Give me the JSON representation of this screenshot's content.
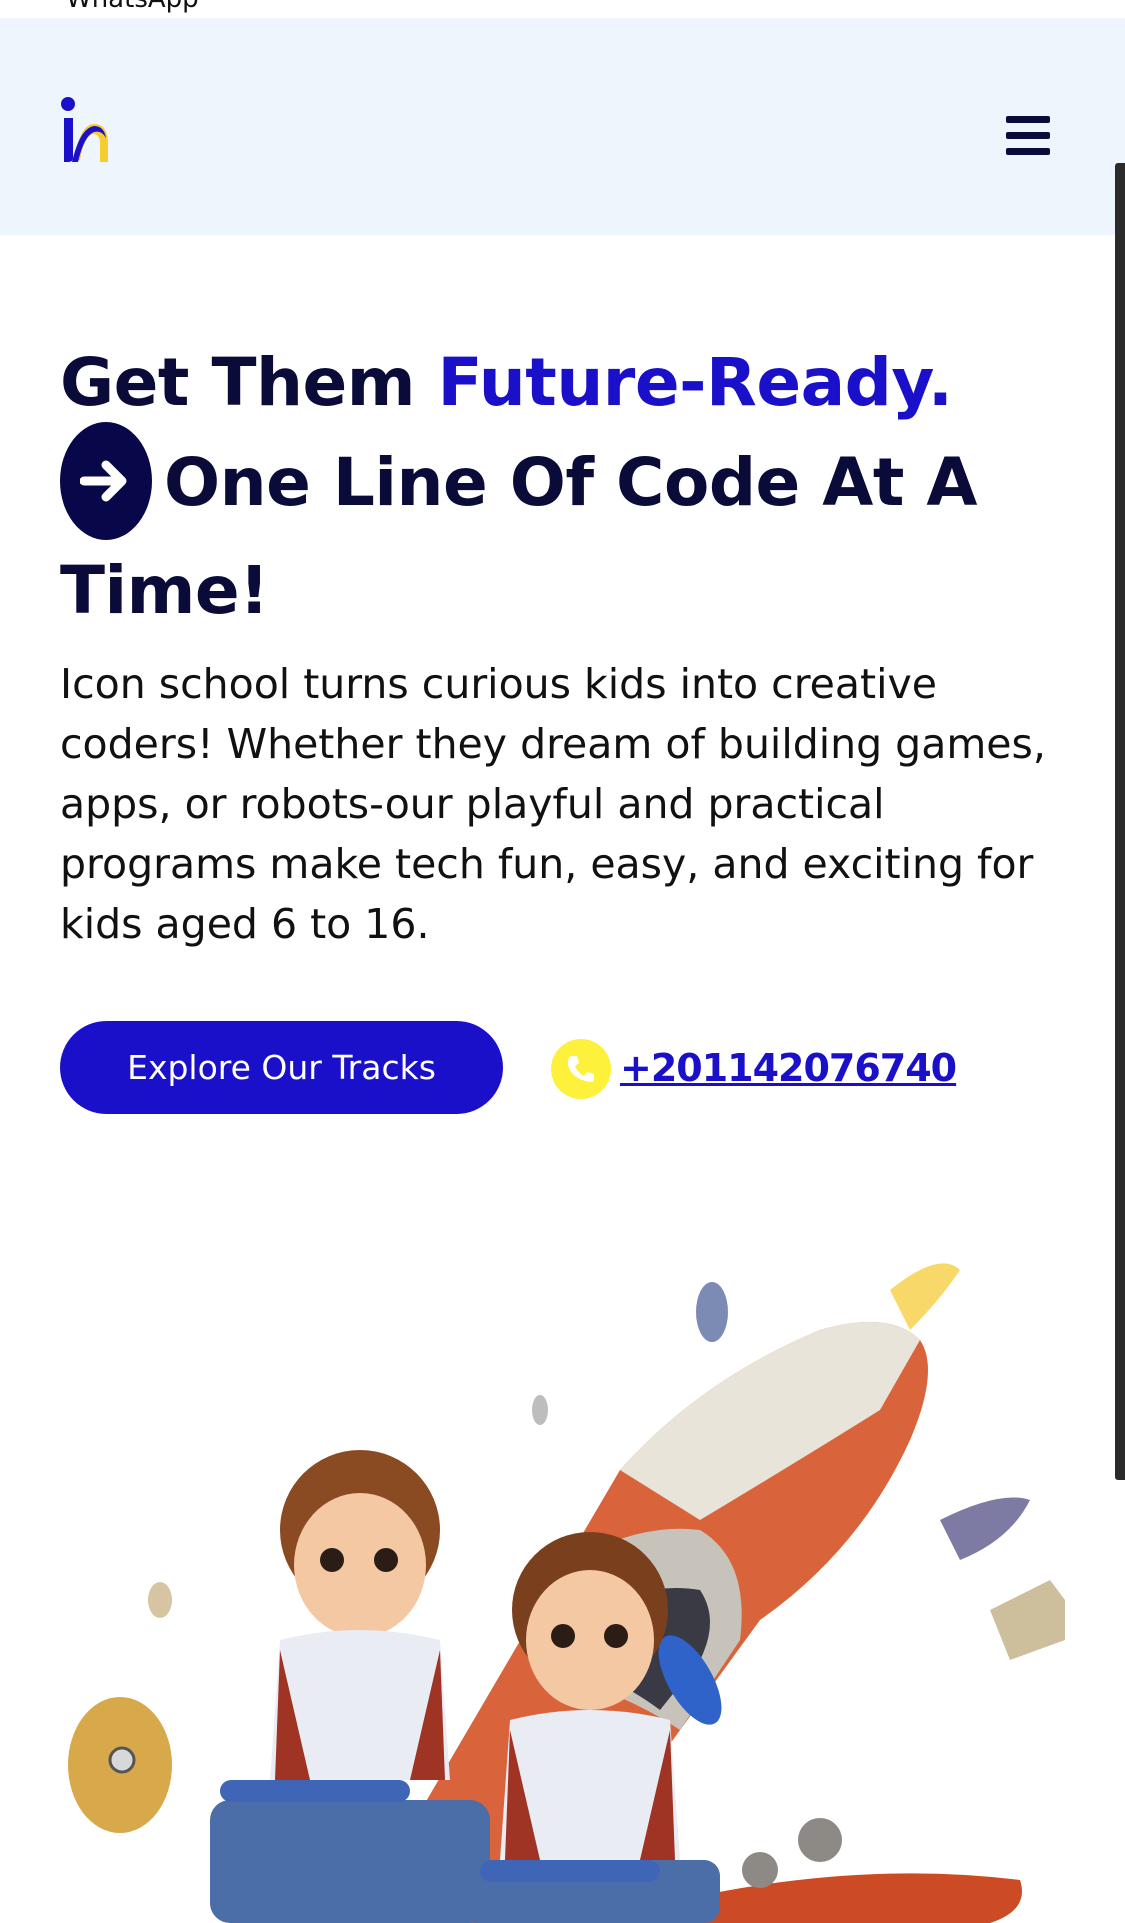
{
  "top_strip": {
    "text": "WhatsApp"
  },
  "header": {
    "logo_alt": "Icon school logo"
  },
  "hero": {
    "title_part1": "Get Them ",
    "title_accent": "Future-Ready.",
    "title_part2": "One Line Of Code At A Time!",
    "description": "Icon school turns curious kids into creative coders! Whether they dream of building games, apps, or robots-our playful and practical programs make tech fun, easy, and exciting for kids aged 6 to 16.",
    "cta_label": "Explore Our Tracks",
    "phone": "+201142076740"
  },
  "colors": {
    "brand_blue": "#1a10c9",
    "navy": "#0b0b3a",
    "header_bg": "#eff5fd",
    "phone_yellow": "#fdf13c"
  },
  "icons": [
    "logo-icon",
    "menu-icon",
    "arrow-right-icon",
    "phone-icon"
  ]
}
